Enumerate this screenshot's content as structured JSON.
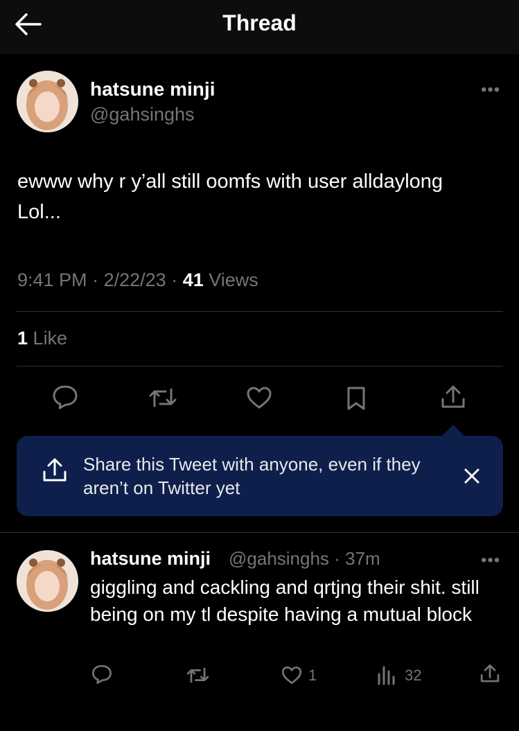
{
  "header": {
    "title": "Thread",
    "back_icon": "arrow-left-icon"
  },
  "tweet": {
    "author_name": "hatsune minji",
    "author_handle": "@gahsinghs",
    "text": "ewww why r y’all still oomfs with user alldaylong Lol...",
    "time": "9:41 PM",
    "date": "2/22/23",
    "views_count": "41",
    "views_label": "Views",
    "likes_count": "1",
    "likes_label": "Like",
    "more_icon": "more-horizontal-icon"
  },
  "actions": [
    "reply-icon",
    "retweet-icon",
    "like-icon",
    "bookmark-icon",
    "share-icon"
  ],
  "share_banner": {
    "text": "Share this Tweet with anyone, even if they aren’t on Twitter yet",
    "close_icon": "close-icon"
  },
  "reply": {
    "author_name": "hatsune minji",
    "author_handle": "@gahsinghs",
    "time": "37m",
    "text": "giggling and cackling and qrtjng their shit. still being on my tl despite having a mutual block",
    "likes_count": "1",
    "views_count": "32"
  },
  "colors": {
    "background": "#000000",
    "header_bg": "#0d0d0d",
    "secondary_text": "#71767b",
    "divider": "#2f3336",
    "banner_bg": "#0e1f4c"
  }
}
